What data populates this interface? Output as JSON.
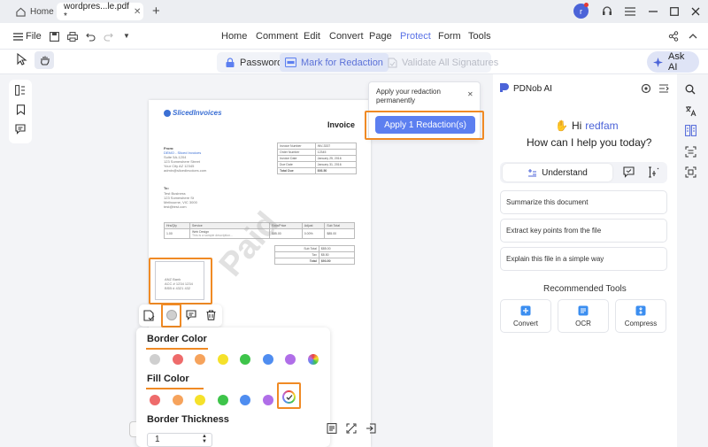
{
  "titlebar": {
    "home_label": "Home",
    "doc_tab_label": "wordpres...le.pdf *",
    "user_initial": "r"
  },
  "menu": {
    "file_label": "File",
    "items": [
      "Home",
      "Comment",
      "Edit",
      "Convert",
      "Page",
      "Protect",
      "Form",
      "Tools"
    ],
    "active": "Protect"
  },
  "subtoolbar": {
    "password": "Password",
    "mark_for_redaction": "Mark for Redaction",
    "validate_signatures": "Validate All Signatures",
    "ask_ai": "Ask AI"
  },
  "redaction_popup": {
    "message": "Apply your redaction permanently",
    "apply_button": "Apply 1 Redaction(s)"
  },
  "document": {
    "logo_text": "SlicedInvoices",
    "watermark": "Paid",
    "heading": "Invoice",
    "from_label": "From:",
    "from_lines": [
      "DEMO - Sliced Invoices",
      "Suite 5A-1204",
      "123 Somewhere Street",
      "Your City AZ 12345",
      "admin@slicedinvoices.com"
    ],
    "to_label": "To:",
    "to_lines": [
      "Test Business",
      "123 Somewhere St",
      "Melbourne, VIC 3000",
      "test@test.com"
    ],
    "meta_rows": [
      [
        "Invoice Number",
        "INV-3337"
      ],
      [
        "Order Number",
        "12345"
      ],
      [
        "Invoice Date",
        "January 25, 2016"
      ],
      [
        "Due Date",
        "January 31, 2016"
      ],
      [
        "Total Due",
        "$93.50"
      ]
    ],
    "items_headers": [
      "Hrs/Qty",
      "Service",
      "Rate/Price",
      "Adjust",
      "Sub Total"
    ],
    "items_row": [
      "1.00",
      "Web Design",
      "$85.00",
      "0.00%",
      "$85.00"
    ],
    "items_desc": "This is a sample description...",
    "totals": [
      [
        "Sub Total",
        "$85.00"
      ],
      [
        "Tax",
        "$8.50"
      ],
      [
        "Total",
        "$93.50"
      ]
    ],
    "bank_lines": [
      "ANZ Bank",
      "ACC # 1234 1234",
      "BSB # 4321 432"
    ]
  },
  "properties": {
    "border_color_title": "Border Color",
    "fill_color_title": "Fill Color",
    "border_thickness_title": "Border Thickness",
    "thickness_value": "1",
    "border_colors": [
      "#cfcfcf",
      "#ee6b6b",
      "#f6a35c",
      "#f5e12a",
      "#3ec44a",
      "#4f8df0",
      "#b06ee8",
      "rainbow"
    ],
    "fill_colors": [
      "#ee6b6b",
      "#f6a35c",
      "#f5e12a",
      "#3ec44a",
      "#4f8df0",
      "#b06ee8",
      "rainbow-selected"
    ]
  },
  "ai": {
    "title": "PDNob AI",
    "greeting_hi": "Hi",
    "username": "redfam",
    "question": "How can I help you today?",
    "understand_label": "Understand",
    "suggestions": [
      "Summarize this document",
      "Extract key points from the file",
      "Explain this file in a simple way"
    ],
    "recommended_title": "Recommended Tools",
    "tools": [
      "Convert",
      "OCR",
      "Compress"
    ]
  },
  "colors": {
    "accent": "#5c7ff0",
    "highlight": "#f08a24"
  }
}
